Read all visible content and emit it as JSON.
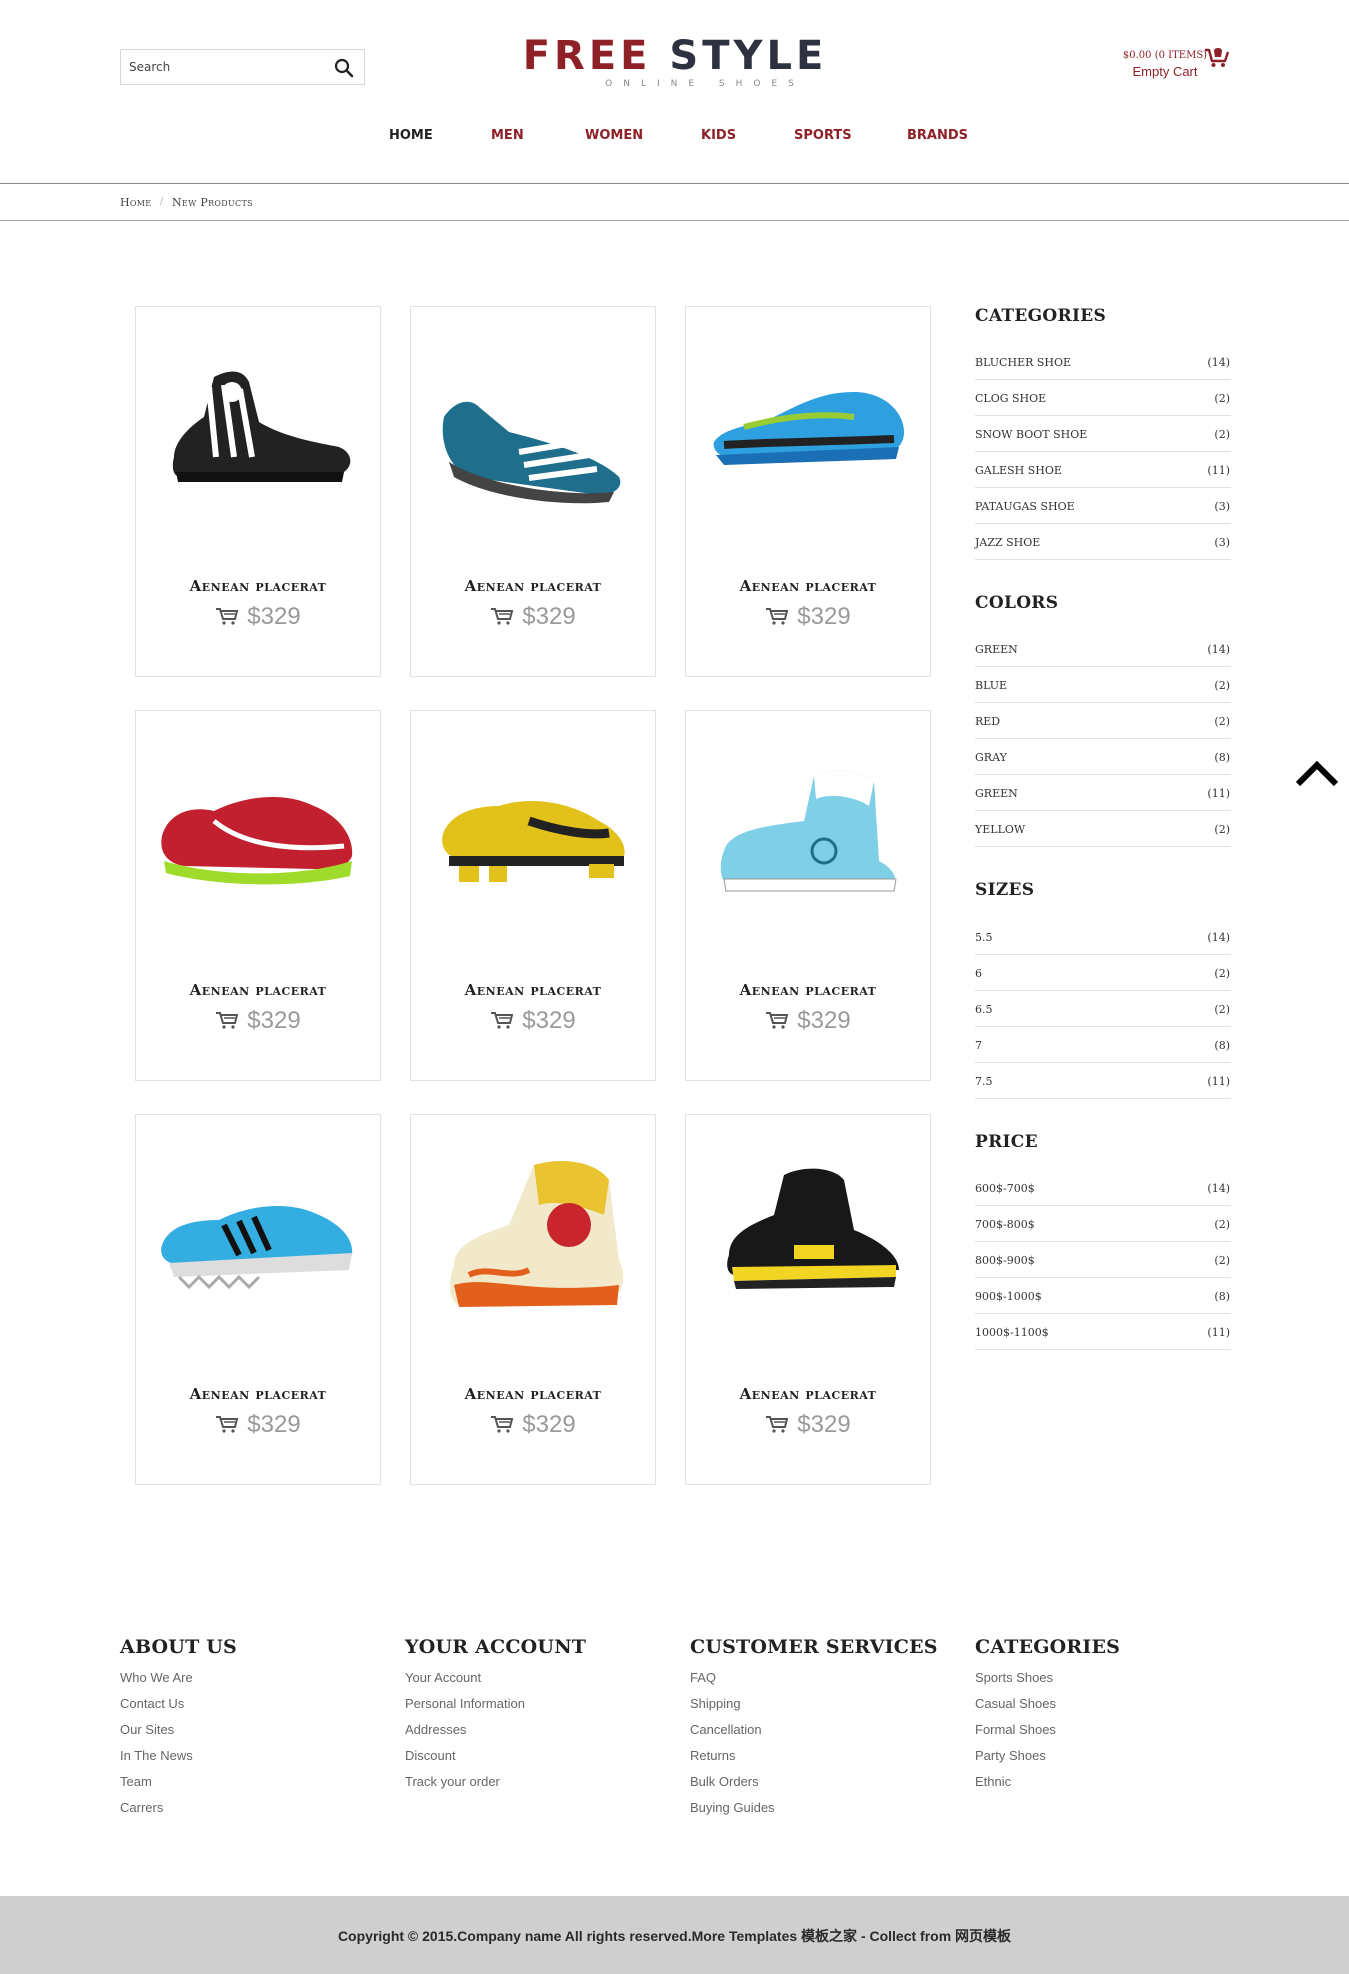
{
  "header": {
    "search_placeholder": "Search",
    "logo_free": "FREE",
    "logo_style": "STYLE",
    "logo_tagline": "ONLINE SHOES",
    "cart_total": "$0.00 (0 ITEMS)",
    "cart_status": "Empty Cart"
  },
  "nav": {
    "items": [
      "HOME",
      "MEN",
      "WOMEN",
      "KIDS",
      "SPORTS",
      "BRANDS"
    ],
    "active": "HOME"
  },
  "breadcrumb": {
    "home": "Home",
    "current": "New Products"
  },
  "products": [
    {
      "name": "Aenean placerat",
      "price": "$329",
      "image": "black-white-striped-hightop-sneaker"
    },
    {
      "name": "Aenean placerat",
      "price": "$329",
      "image": "teal-grey-striped-trail-shoe"
    },
    {
      "name": "Aenean placerat",
      "price": "$329",
      "image": "blue-neon-green-running-shoe"
    },
    {
      "name": "Aenean placerat",
      "price": "$329",
      "image": "red-lime-running-shoe"
    },
    {
      "name": "Aenean placerat",
      "price": "$329",
      "image": "yellow-black-shox-shoe"
    },
    {
      "name": "Aenean placerat",
      "price": "$329",
      "image": "light-blue-hightop-dunk"
    },
    {
      "name": "Aenean placerat",
      "price": "$329",
      "image": "sky-blue-black-stripe-running-shoe"
    },
    {
      "name": "Aenean placerat",
      "price": "$329",
      "image": "devil-graphic-hightop-sneaker"
    },
    {
      "name": "Aenean placerat",
      "price": "$329",
      "image": "black-yellow-basketball-shoe"
    }
  ],
  "sidebar": {
    "categories": {
      "title": "CATEGORIES",
      "items": [
        {
          "label": "BLUCHER SHOE",
          "count": "(14)"
        },
        {
          "label": "CLOG SHOE",
          "count": "(2)"
        },
        {
          "label": "SNOW BOOT SHOE",
          "count": "(2)"
        },
        {
          "label": "GALESH SHOE",
          "count": "(11)"
        },
        {
          "label": "PATAUGAS SHOE",
          "count": "(3)"
        },
        {
          "label": "JAZZ SHOE",
          "count": "(3)"
        }
      ]
    },
    "colors": {
      "title": "COLORS",
      "items": [
        {
          "label": "GREEN",
          "count": "(14)"
        },
        {
          "label": "BLUE",
          "count": "(2)"
        },
        {
          "label": "RED",
          "count": "(2)"
        },
        {
          "label": "GRAY",
          "count": "(8)"
        },
        {
          "label": "GREEN",
          "count": "(11)"
        },
        {
          "label": "YELLOW",
          "count": "(2)"
        }
      ]
    },
    "sizes": {
      "title": "SIZES",
      "items": [
        {
          "label": "5.5",
          "count": "(14)"
        },
        {
          "label": "6",
          "count": "(2)"
        },
        {
          "label": "6.5",
          "count": "(2)"
        },
        {
          "label": "7",
          "count": "(8)"
        },
        {
          "label": "7.5",
          "count": "(11)"
        }
      ]
    },
    "price": {
      "title": "PRICE",
      "items": [
        {
          "label": "600$-700$",
          "count": "(14)"
        },
        {
          "label": "700$-800$",
          "count": "(2)"
        },
        {
          "label": "800$-900$",
          "count": "(2)"
        },
        {
          "label": "900$-1000$",
          "count": "(8)"
        },
        {
          "label": "1000$-1100$",
          "count": "(11)"
        }
      ]
    }
  },
  "footer": {
    "columns": [
      {
        "title": "ABOUT US",
        "links": [
          "Who We Are",
          "Contact Us",
          "Our Sites",
          "In The News",
          "Team",
          "Carrers"
        ]
      },
      {
        "title": "YOUR ACCOUNT",
        "links": [
          "Your Account",
          "Personal Information",
          "Addresses",
          "Discount",
          "Track your order"
        ]
      },
      {
        "title": "CUSTOMER SERVICES",
        "links": [
          "FAQ",
          "Shipping",
          "Cancellation",
          "Returns",
          "Bulk Orders",
          "Buying Guides"
        ]
      },
      {
        "title": "CATEGORIES",
        "links": [
          "Sports Shoes",
          "Casual Shoes",
          "Formal Shoes",
          "Party Shoes",
          "Ethnic"
        ]
      }
    ],
    "copyright": "Copyright © 2015.Company name All rights reserved.More Templates 模板之家 - Collect from 网页模板"
  },
  "colors": {
    "brand_red": "#8e2027",
    "logo_dark": "#2d3140",
    "price_grey": "#999999",
    "footer_bar": "#cfcfcf"
  }
}
